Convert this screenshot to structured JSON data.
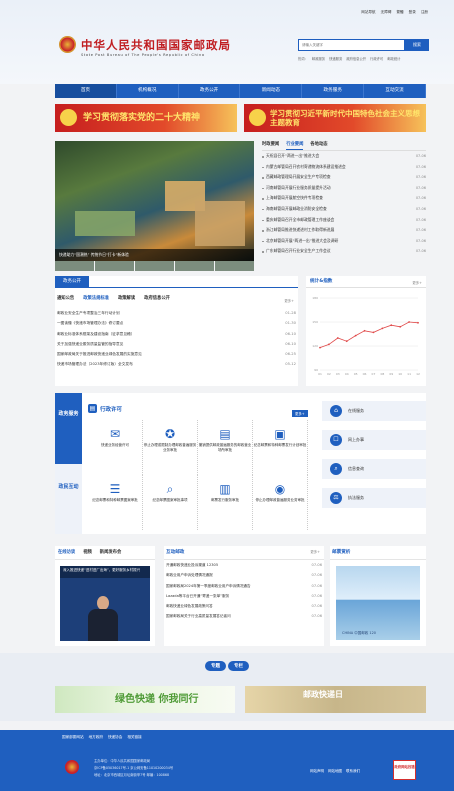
{
  "header": {
    "top_links": [
      "网站导航",
      "无障碍",
      "繁體",
      "登录",
      "注册"
    ],
    "title": "中华人民共和国国家邮政局",
    "subtitle": "State Post Bureau of The People's Republic of China",
    "search_placeholder": "请输入关键字",
    "search_button": "搜索",
    "hot_words": [
      "热词：",
      "邮政服务",
      "快递服务",
      "政府信息公开",
      "行政许可",
      "邮政统计"
    ]
  },
  "nav": [
    "首页",
    "机构概况",
    "政务公开",
    "新闻动态",
    "政务服务",
    "互动交流"
  ],
  "banners": {
    "left": "学习贯彻落实党的二十大精神",
    "right": "学习贯彻习近平新时代中国特色社会主义思想主题教育"
  },
  "carousel": {
    "caption": "快递助力“国潮热” 传统节日“打卡”新体验"
  },
  "news": {
    "tabs": [
      "时政要闻",
      "行业要闻",
      "各地动态"
    ],
    "active_tab": "行业要闻",
    "items": [
      {
        "title": "天祝县召开“两进一出”推进大会",
        "date": "07-06"
      },
      {
        "title": "内蒙古邮管局召开农村寄递物流体系建设推进会",
        "date": "07-06"
      },
      {
        "title": "西藏邮政管理局开展安全生产专项检查",
        "date": "07-06"
      },
      {
        "title": "河南邮管局开展行业服务质量提升活动",
        "date": "07-06"
      },
      {
        "title": "上海邮管局开展航空快件专项检查",
        "date": "07-06"
      },
      {
        "title": "海南邮管局开展邮政业消防安全检查",
        "date": "07-06"
      },
      {
        "title": "重庆邮管局召开全市邮政管理工作座谈会",
        "date": "07-06"
      },
      {
        "title": "浙江邮管局推进快递进村工作取得新进展",
        "date": "07-06"
      },
      {
        "title": "北京邮管局开展“两进一出”推进大会及调研",
        "date": "07-06"
      },
      {
        "title": "广东邮管局召开行业安全生产工作会议",
        "date": "07-06"
      }
    ]
  },
  "gov": {
    "title": "政务公开",
    "tabs": [
      "通知公告",
      "政策法规标准",
      "政策解读",
      "政府信息公开"
    ],
    "active_tab": "政策法规标准",
    "more": "更多+",
    "items": [
      {
        "title": "邮政业安全生产专项整治三年行动计划",
        "date": "01-28"
      },
      {
        "title": "一图读懂《快递市场管理办法》修订要点",
        "date": "01-30"
      },
      {
        "title": "邮政业标准体系框架及建设指南（征求意见稿）",
        "date": "06-10"
      },
      {
        "title": "关于加强快递业服务质量监管的指导意见",
        "date": "06-10"
      },
      {
        "title": "国家邮政局关于推进邮政快递业绿色发展的实施意见",
        "date": "06-25"
      },
      {
        "title": "快递市场管理办法（2023年修订版）全文发布",
        "date": "05-12"
      }
    ]
  },
  "stats": {
    "title": "统计&指数",
    "more": "更多+"
  },
  "chart_data": {
    "type": "line",
    "x": [
      "01",
      "02",
      "03",
      "04",
      "05",
      "06",
      "07",
      "08",
      "09",
      "10",
      "11",
      "12"
    ],
    "series": [
      {
        "values": [
          118,
          122,
          130,
          126,
          133,
          139,
          137,
          142,
          146,
          144,
          150,
          149
        ]
      }
    ],
    "ylim": [
      90,
      180
    ],
    "grid": true
  },
  "services": {
    "side_a": "政务服务",
    "side_b": "政民互动",
    "title": "行政许可",
    "more": "更多+",
    "grid": [
      {
        "icon": "envelope-icon",
        "label": "快递业务经营许可"
      },
      {
        "icon": "stamp-icon",
        "label": "停止办理或限制办理邮政普遍服务业务审批"
      },
      {
        "icon": "doc-icon",
        "label": "撤销提供邮政普遍服务的邮政营业场所审批"
      },
      {
        "icon": "stamp2-icon",
        "label": "纪念邮票和特种邮票发行计划审批"
      },
      {
        "icon": "doc2-icon",
        "label": "纪念邮票和特种邮票图案审批"
      },
      {
        "icon": "search-doc-icon",
        "label": "纪念邮票图案审批事项"
      },
      {
        "icon": "doc3-icon",
        "label": "邮票发行服务审批"
      },
      {
        "icon": "browser-icon",
        "label": "停止办理邮政普遍服务业务审批"
      }
    ],
    "links": [
      "在线服务",
      "网上办事",
      "信息查询",
      "执法服务"
    ]
  },
  "media": {
    "tabs": [
      "在线访谈",
      "视频",
      "新闻发布会"
    ],
    "active_tab": "在线访谈",
    "video_caption": "深入推进快递“进村进厂出海”，更好服务乡村振兴",
    "interact_title": "互动邮政",
    "more": "更多+",
    "items": [
      {
        "title": "开通邮政快递业投诉渠道 12305",
        "date": "07-06"
      },
      {
        "title": "邮政业用户申诉处理情况通报",
        "date": "07-06"
      },
      {
        "title": "国家邮政局2024年第一季度邮政业用户申诉情况通告",
        "date": "07-06"
      },
      {
        "title": "Lazada等平台已开通“寄递一张单”服务",
        "date": "07-06"
      },
      {
        "title": "邮政快递业绿色发展政策问答",
        "date": "07-06"
      },
      {
        "title": "国家邮政局关于行业高质量发展答记者问",
        "date": "07-06"
      }
    ],
    "stamps_title": "邮票赏析",
    "stamp_text": "CHINA 中国邮政 120"
  },
  "special": {
    "labels": [
      "专题",
      "专栏"
    ],
    "ad_left": "绿色快递 你我同行",
    "ad_right": "邮政快递日"
  },
  "footer": {
    "links": [
      "国家部委网站",
      "地方政府",
      "快递协会",
      "相关链接"
    ],
    "info": [
      "主办单位：中华人民共和国国家邮政局",
      "京ICP备05036017号-1  京公网安备11010200034号",
      "地址：北京市西城区月坛南街甲7号  邮编：100868"
    ],
    "right_links": [
      "网站声明",
      "网站地图",
      "联系我们"
    ],
    "error_badge": "政府网站找错"
  }
}
